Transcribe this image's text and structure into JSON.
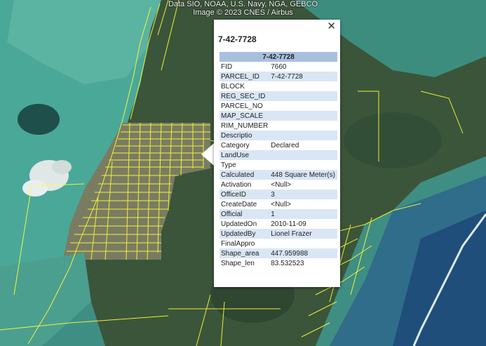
{
  "popup": {
    "title": "7-42-7728",
    "table_header": "7-42-7728",
    "close_glyph": "✕",
    "rows": [
      {
        "k": "FID",
        "v": "7660"
      },
      {
        "k": "PARCEL_ID",
        "v": "7-42-7728"
      },
      {
        "k": "BLOCK",
        "v": ""
      },
      {
        "k": "REG_SEC_ID",
        "v": ""
      },
      {
        "k": "PARCEL_NO",
        "v": ""
      },
      {
        "k": "MAP_SCALE",
        "v": ""
      },
      {
        "k": "RIM_NUMBER",
        "v": ""
      },
      {
        "k": "Descriptio",
        "v": ""
      },
      {
        "k": "Category",
        "v": "Declared"
      },
      {
        "k": "LandUse",
        "v": ""
      },
      {
        "k": "Type",
        "v": ""
      },
      {
        "k": "Calculated",
        "v": "448 Square Meter(s)"
      },
      {
        "k": "Activation",
        "v": "<Null>"
      },
      {
        "k": "OfficeID",
        "v": "3"
      },
      {
        "k": "CreateDate",
        "v": "<Null>"
      },
      {
        "k": "Official",
        "v": "1"
      },
      {
        "k": "UpdatedOn",
        "v": "2010-11-09"
      },
      {
        "k": "UpdatedBy",
        "v": "Lionel Frazer"
      },
      {
        "k": "FinalAppro",
        "v": ""
      },
      {
        "k": "Shape_area",
        "v": "447.959988"
      },
      {
        "k": "Shape_len",
        "v": "83.532523"
      }
    ]
  },
  "attribution": {
    "line1": "Data SIO, NOAA, U.S. Navy, NGA, GEBCO",
    "line2": "Image © 2023 CNES / Airbus"
  },
  "colors": {
    "parcel_lines": "#ffff33",
    "water": "#3f9e8c",
    "land": "#3e5a3e",
    "table_header": "#a8c0e0",
    "row_alt": "#d9e6f5"
  }
}
